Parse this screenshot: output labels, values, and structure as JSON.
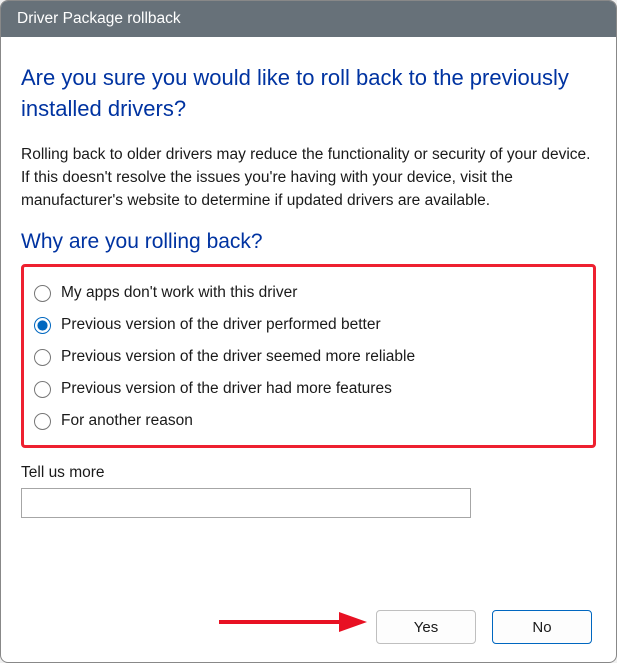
{
  "window": {
    "title": "Driver Package rollback"
  },
  "heading": "Are you sure you would like to roll back to the previously installed drivers?",
  "description": "Rolling back to older drivers may reduce the functionality or security of your device.  If this doesn't resolve the issues you're having with your device, visit the manufacturer's website to determine if updated drivers are available.",
  "subheading": "Why are you rolling back?",
  "reasons": [
    {
      "label": "My apps don't work with this driver",
      "checked": false
    },
    {
      "label": "Previous version of the driver performed better",
      "checked": true
    },
    {
      "label": "Previous version of the driver seemed more reliable",
      "checked": false
    },
    {
      "label": "Previous version of the driver had more features",
      "checked": false
    },
    {
      "label": "For another reason",
      "checked": false
    }
  ],
  "tell_more": {
    "label": "Tell us more",
    "value": ""
  },
  "buttons": {
    "yes": "Yes",
    "no": "No"
  },
  "annotation": {
    "highlight_color": "#ee2030",
    "arrow_color": "#e81123"
  }
}
